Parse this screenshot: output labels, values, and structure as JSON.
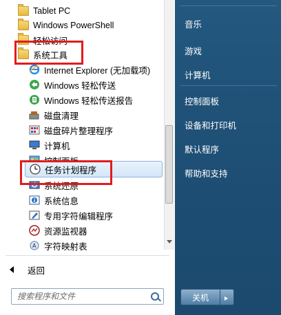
{
  "programs": [
    {
      "label": "Tablet PC",
      "icon": "folder-icon"
    },
    {
      "label": "Windows PowerShell",
      "icon": "folder-icon"
    },
    {
      "label": "轻松访问",
      "icon": "folder-icon"
    },
    {
      "label": "系统工具",
      "icon": "folder-icon"
    },
    {
      "label": "Internet Explorer (无加载项)",
      "icon": "internet-explorer-icon"
    },
    {
      "label": "Windows 轻松传送",
      "icon": "easy-transfer-icon"
    },
    {
      "label": "Windows 轻松传送报告",
      "icon": "easy-transfer-report-icon"
    },
    {
      "label": "磁盘清理",
      "icon": "disk-cleanup-icon"
    },
    {
      "label": "磁盘碎片整理程序",
      "icon": "defragmenter-icon"
    },
    {
      "label": "计算机",
      "icon": "computer-icon"
    },
    {
      "label": "控制面板",
      "icon": "control-panel-icon"
    },
    {
      "label": "任务计划程序",
      "icon": "task-scheduler-icon"
    },
    {
      "label": "系统还原",
      "icon": "system-restore-icon"
    },
    {
      "label": "系统信息",
      "icon": "system-info-icon"
    },
    {
      "label": "专用字符编辑程序",
      "icon": "char-editor-icon"
    },
    {
      "label": "资源监视器",
      "icon": "resource-monitor-icon"
    },
    {
      "label": "字符映射表",
      "icon": "character-map-icon"
    }
  ],
  "back": {
    "label": "返回"
  },
  "search": {
    "placeholder": "搜索程序和文件"
  },
  "right": {
    "items": [
      "音乐",
      "游戏",
      "计算机",
      "控制面板",
      "设备和打印机",
      "默认程序",
      "帮助和支持"
    ],
    "shutdown_label": "关机"
  },
  "colors": {
    "highlight_box": "#e21b1b",
    "right_pane": "#1f4f73",
    "selection": "#d4e6f8"
  }
}
